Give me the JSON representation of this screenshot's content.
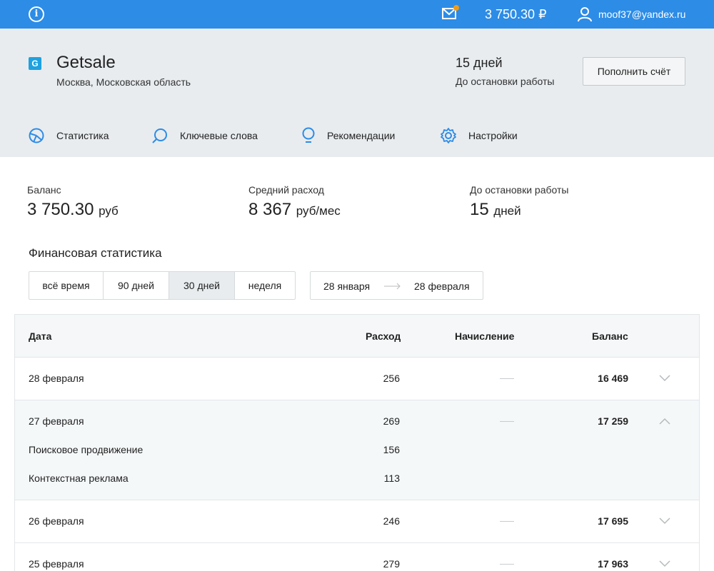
{
  "topbar": {
    "info_icon": "info-icon",
    "balance": "3 750.30 ₽",
    "email": "moof37@yandex.ru"
  },
  "header": {
    "company": "Getsale",
    "location": "Москва, Московская область",
    "days_value": "15 дней",
    "days_label": "До остановки работы",
    "topup_label": "Пополнить счёт"
  },
  "nav": [
    {
      "label": "Статистика",
      "icon": "statistics-icon"
    },
    {
      "label": "Ключевые слова",
      "icon": "search-icon"
    },
    {
      "label": "Рекомендации",
      "icon": "lightbulb-icon"
    },
    {
      "label": "Настройки",
      "icon": "gear-icon"
    }
  ],
  "stats": [
    {
      "label": "Баланс",
      "value": "3 750.30",
      "unit": "руб"
    },
    {
      "label": "Средний расход",
      "value": "8 367",
      "unit": "руб/мес"
    },
    {
      "label": "До остановки работы",
      "value": "15",
      "unit": "дней"
    }
  ],
  "finance": {
    "title": "Финансовая статистика",
    "periods": [
      "всё время",
      "90 дней",
      "30 дней",
      "неделя"
    ],
    "active_period": "30 дней",
    "range_from": "28 января",
    "range_to": "28 февраля"
  },
  "table": {
    "headers": {
      "date": "Дата",
      "expense": "Расход",
      "credit": "Начисление",
      "balance": "Баланс"
    },
    "rows": [
      {
        "date": "28 февраля",
        "expense": "256",
        "balance": "16 469"
      },
      {
        "date": "27 февраля",
        "expense": "269",
        "balance": "17 259",
        "details": [
          {
            "name": "Поисковое продвижение",
            "value": "156"
          },
          {
            "name": "Контекстная реклама",
            "value": "113"
          }
        ]
      },
      {
        "date": "26 февраля",
        "expense": "246",
        "balance": "17 695"
      },
      {
        "date": "25 февраля",
        "expense": "279",
        "balance": "17 963"
      }
    ]
  }
}
